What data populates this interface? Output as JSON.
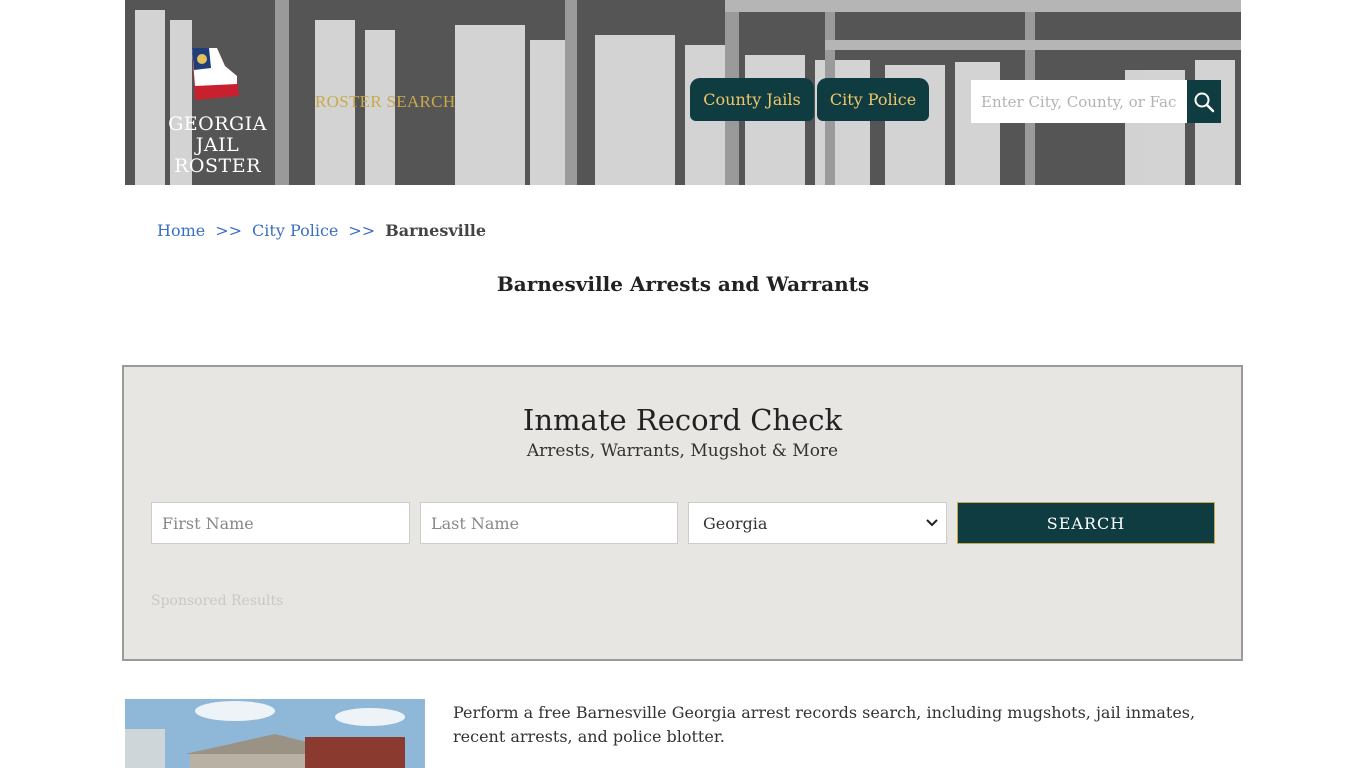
{
  "header": {
    "logo_line1": "GEORGIA",
    "logo_line2": "JAIL ROSTER",
    "roster_search_label": "ROSTER SEARCH",
    "nav": [
      {
        "label": "County Jails"
      },
      {
        "label": "City Police"
      }
    ],
    "search": {
      "placeholder": "Enter City, County, or Facility"
    }
  },
  "breadcrumb": {
    "home": "Home",
    "sep": ">>",
    "city_police": "City Police",
    "current": "Barnesville"
  },
  "page_title": "Barnesville Arrests and Warrants",
  "record_check": {
    "title": "Inmate Record Check",
    "subtitle": "Arrests, Warrants, Mugshot & More",
    "first_name_placeholder": "First Name",
    "last_name_placeholder": "Last Name",
    "state_value": "Georgia",
    "search_label": "SEARCH",
    "sponsored": "Sponsored Results"
  },
  "intro_text": "Perform a free Barnesville Georgia arrest records search, including mugshots, jail inmates, recent arrests, and police blotter.",
  "colors": {
    "accent_dark": "#0f3c41",
    "gold": "#c9a94a",
    "link": "#3a6fc4",
    "panel_bg": "#e7e6e2"
  }
}
